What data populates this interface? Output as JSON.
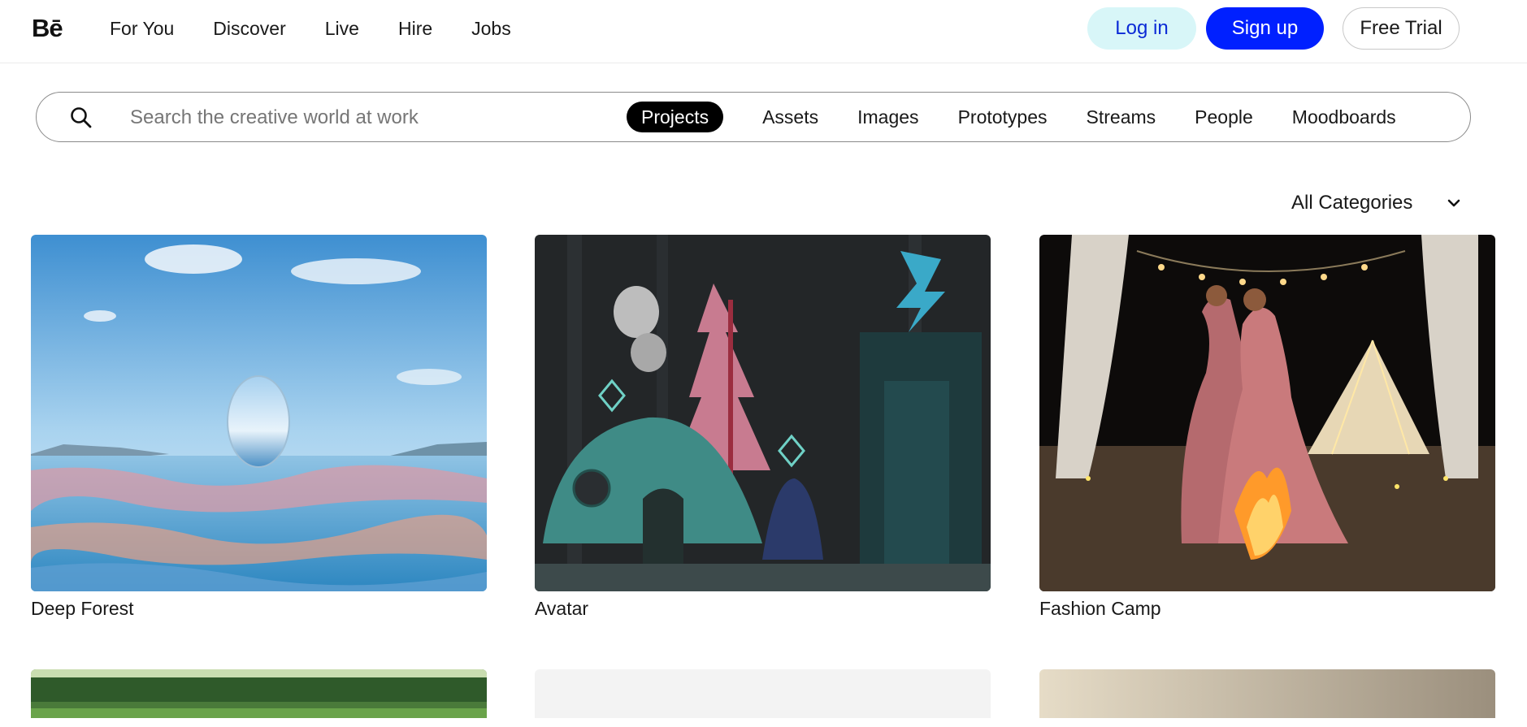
{
  "header": {
    "logo": "Bē",
    "nav": [
      "For You",
      "Discover",
      "Live",
      "Hire",
      "Jobs"
    ],
    "login_label": "Log in",
    "signup_label": "Sign up",
    "trial_label": "Free Trial"
  },
  "search": {
    "placeholder": "Search the creative world at work",
    "value": "",
    "tabs": [
      "Projects",
      "Assets",
      "Images",
      "Prototypes",
      "Streams",
      "People",
      "Moodboards"
    ],
    "active_tab": "Projects"
  },
  "filter": {
    "category": "All Categories"
  },
  "projects": [
    {
      "title": "Deep Forest"
    },
    {
      "title": "Avatar"
    },
    {
      "title": "Fashion Camp"
    }
  ],
  "colors": {
    "login_bg": "#d8f6f8",
    "login_text": "#0b2ad6",
    "signup_bg": "#0020ff",
    "active_tab_bg": "#000000"
  },
  "icons": {
    "search": "search-icon",
    "dropdown": "chevron-down-icon"
  }
}
